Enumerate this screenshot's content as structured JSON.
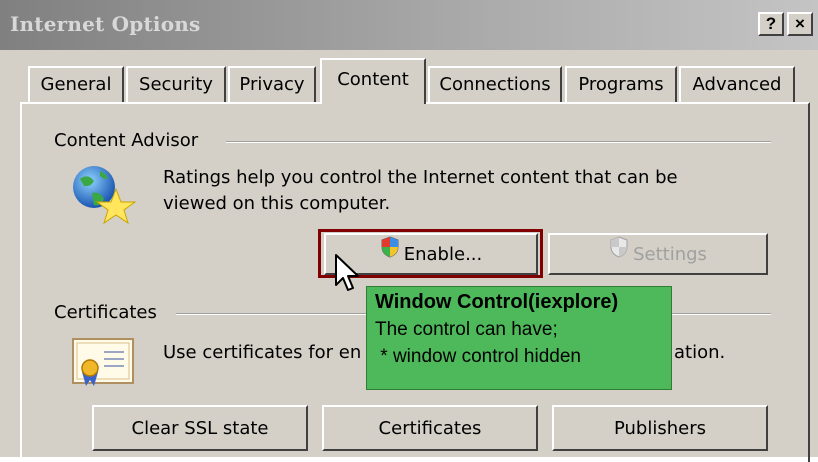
{
  "window": {
    "title": "Internet Options",
    "help_button": "?",
    "close_button": "×"
  },
  "tabs": [
    {
      "label": "General",
      "active": false
    },
    {
      "label": "Security",
      "active": false
    },
    {
      "label": "Privacy",
      "active": false
    },
    {
      "label": "Content",
      "active": true
    },
    {
      "label": "Connections",
      "active": false
    },
    {
      "label": "Programs",
      "active": false
    },
    {
      "label": "Advanced",
      "active": false
    }
  ],
  "content_advisor": {
    "label": "Content Advisor",
    "description_line1": "Ratings help you control the Internet content that can be",
    "description_line2": "viewed on this computer.",
    "icon": "globe-star-icon",
    "enable_button": "Enable...",
    "settings_button": "Settings",
    "settings_enabled": false
  },
  "certificates": {
    "label": "Certificates",
    "description_left": "Use certificates for en",
    "description_right": "ation.",
    "icon": "certificate-icon",
    "buttons": {
      "clear_ssl": "Clear SSL state",
      "certificates": "Certificates",
      "publishers": "Publishers"
    }
  },
  "tooltip": {
    "title": "Window Control(iexplore)",
    "line1": "The control can have;",
    "line2": " * window control hidden",
    "background": "#4db95a"
  },
  "highlight_color": "#800000"
}
